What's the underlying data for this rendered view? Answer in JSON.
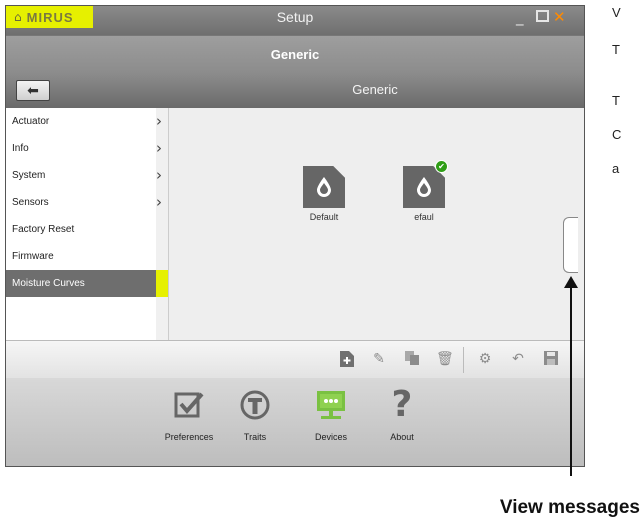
{
  "window": {
    "brand": "MIRUS",
    "title": "Setup",
    "subheader": "Generic",
    "nav_title": "Generic"
  },
  "sidebar": {
    "items": [
      {
        "label": "Actuator",
        "has_children": true
      },
      {
        "label": "Info",
        "has_children": true
      },
      {
        "label": "System",
        "has_children": true
      },
      {
        "label": "Sensors",
        "has_children": true
      },
      {
        "label": "Factory Reset",
        "has_children": false
      },
      {
        "label": "Firmware",
        "has_children": false
      },
      {
        "label": "Moisture Curves",
        "has_children": false,
        "selected": true
      }
    ]
  },
  "files": [
    {
      "label": "Default",
      "active": false
    },
    {
      "label": "efaul",
      "active": true
    }
  ],
  "bottom_nav": [
    {
      "label": "Preferences",
      "icon": "checkbox-icon"
    },
    {
      "label": "Traits",
      "icon": "traits-icon"
    },
    {
      "label": "Devices",
      "icon": "devices-icon",
      "selected": true
    },
    {
      "label": "About",
      "icon": "question-icon"
    }
  ],
  "side_text": [
    "V",
    "T",
    "T",
    "C",
    "a"
  ],
  "callout": {
    "label": "View messages"
  },
  "colors": {
    "brand_yellow": "#e6f000",
    "devices_green": "#7ac142",
    "active_badge": "#2f9e16",
    "close_orange": "#ff8a00"
  }
}
